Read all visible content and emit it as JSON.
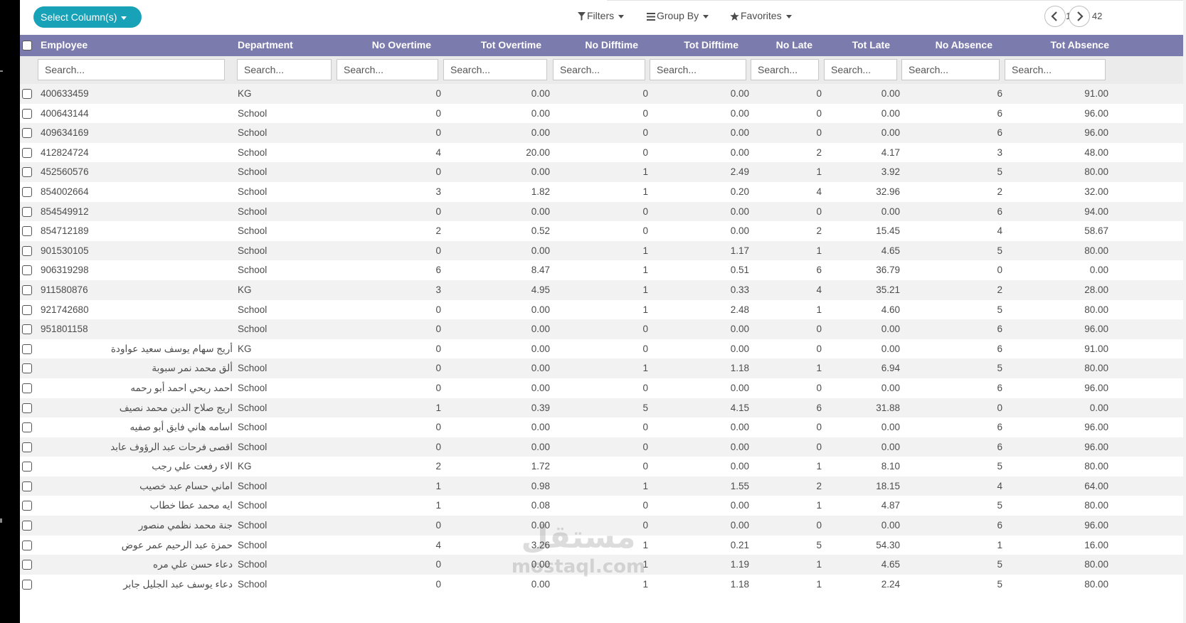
{
  "control_panel": {
    "select_columns_label": "Select Column(s)",
    "filters_label": "Filters",
    "group_by_label": "Group By",
    "favorites_label": "Favorites",
    "pager_value": "1-42 / 42",
    "icons": {
      "filters": "filter-icon",
      "group_by": "list-icon",
      "favorites": "star-icon",
      "pager_prev": "chevron-left-icon",
      "pager_next": "chevron-right-icon"
    }
  },
  "table": {
    "header_color": "#7c7bad",
    "columns": [
      {
        "key": "employee",
        "label": "Employee"
      },
      {
        "key": "department",
        "label": "Department"
      },
      {
        "key": "no_overtime",
        "label": "No Overtime"
      },
      {
        "key": "tot_overtime",
        "label": "Tot Overtime"
      },
      {
        "key": "no_difftime",
        "label": "No Difftime"
      },
      {
        "key": "tot_difftime",
        "label": "Tot Difftime"
      },
      {
        "key": "no_late",
        "label": "No Late"
      },
      {
        "key": "tot_late",
        "label": "Tot Late"
      },
      {
        "key": "no_absence",
        "label": "No Absence"
      },
      {
        "key": "tot_absence",
        "label": "Tot Absence"
      }
    ],
    "search_placeholder": "Search...",
    "rows": [
      [
        "400633459",
        "KG",
        "0",
        "0.00",
        "0",
        "0.00",
        "0",
        "0.00",
        "6",
        "91.00"
      ],
      [
        "400643144",
        "School",
        "0",
        "0.00",
        "0",
        "0.00",
        "0",
        "0.00",
        "6",
        "96.00"
      ],
      [
        "409634169",
        "School",
        "0",
        "0.00",
        "0",
        "0.00",
        "0",
        "0.00",
        "6",
        "96.00"
      ],
      [
        "412824724",
        "School",
        "4",
        "20.00",
        "0",
        "0.00",
        "2",
        "4.17",
        "3",
        "48.00"
      ],
      [
        "452560576",
        "School",
        "0",
        "0.00",
        "1",
        "2.49",
        "1",
        "3.92",
        "5",
        "80.00"
      ],
      [
        "854002664",
        "School",
        "3",
        "1.82",
        "1",
        "0.20",
        "4",
        "32.96",
        "2",
        "32.00"
      ],
      [
        "854549912",
        "School",
        "0",
        "0.00",
        "0",
        "0.00",
        "0",
        "0.00",
        "6",
        "94.00"
      ],
      [
        "854712189",
        "School",
        "2",
        "0.52",
        "0",
        "0.00",
        "2",
        "15.45",
        "4",
        "58.67"
      ],
      [
        "901530105",
        "School",
        "0",
        "0.00",
        "1",
        "1.17",
        "1",
        "4.65",
        "5",
        "80.00"
      ],
      [
        "906319298",
        "School",
        "6",
        "8.47",
        "1",
        "0.51",
        "6",
        "36.79",
        "0",
        "0.00"
      ],
      [
        "911580876",
        "KG",
        "3",
        "4.95",
        "1",
        "0.33",
        "4",
        "35.21",
        "2",
        "28.00"
      ],
      [
        "921742680",
        "School",
        "0",
        "0.00",
        "1",
        "2.48",
        "1",
        "4.60",
        "5",
        "80.00"
      ],
      [
        "951801158",
        "School",
        "0",
        "0.00",
        "0",
        "0.00",
        "0",
        "0.00",
        "6",
        "96.00"
      ],
      [
        "أريج سهام يوسف سعيد عواودة",
        "KG",
        "0",
        "0.00",
        "0",
        "0.00",
        "0",
        "0.00",
        "6",
        "91.00"
      ],
      [
        "ألق محمد نمر سبوبة",
        "School",
        "0",
        "0.00",
        "1",
        "1.18",
        "1",
        "6.94",
        "5",
        "80.00"
      ],
      [
        "احمد ربحي احمد أبو رحمه",
        "School",
        "0",
        "0.00",
        "0",
        "0.00",
        "0",
        "0.00",
        "6",
        "96.00"
      ],
      [
        "اريج صلاح الدين محمد نصيف",
        "School",
        "1",
        "0.39",
        "5",
        "4.15",
        "6",
        "31.88",
        "0",
        "0.00"
      ],
      [
        "اسامه هاني فايق أبو صفيه",
        "School",
        "0",
        "0.00",
        "0",
        "0.00",
        "0",
        "0.00",
        "6",
        "96.00"
      ],
      [
        "اقصى فرحات عبد الرؤوف عابد",
        "School",
        "0",
        "0.00",
        "0",
        "0.00",
        "0",
        "0.00",
        "6",
        "96.00"
      ],
      [
        "الاء رفعت علي رجب",
        "KG",
        "2",
        "1.72",
        "0",
        "0.00",
        "1",
        "8.10",
        "5",
        "80.00"
      ],
      [
        "اماني حسام عبد خصيب",
        "School",
        "1",
        "0.98",
        "1",
        "1.55",
        "2",
        "18.15",
        "4",
        "64.00"
      ],
      [
        "ايه محمد عطا خطاب",
        "School",
        "1",
        "0.08",
        "0",
        "0.00",
        "1",
        "4.87",
        "5",
        "80.00"
      ],
      [
        "جنة محمد نظمي منصور",
        "School",
        "0",
        "0.00",
        "0",
        "0.00",
        "0",
        "0.00",
        "6",
        "96.00"
      ],
      [
        "حمزة عبد الرحيم عمر عوض",
        "School",
        "4",
        "3.26",
        "1",
        "0.21",
        "5",
        "54.30",
        "1",
        "16.00"
      ],
      [
        "دعاء حسن علي مره",
        "School",
        "0",
        "0.00",
        "1",
        "1.19",
        "1",
        "4.65",
        "5",
        "80.00"
      ],
      [
        "دعاء يوسف عبد الجليل جابر",
        "School",
        "0",
        "0.00",
        "1",
        "1.18",
        "1",
        "2.24",
        "5",
        "80.00"
      ]
    ]
  },
  "watermark": {
    "arabic": "مستقل",
    "latin": "mostaql.com"
  }
}
